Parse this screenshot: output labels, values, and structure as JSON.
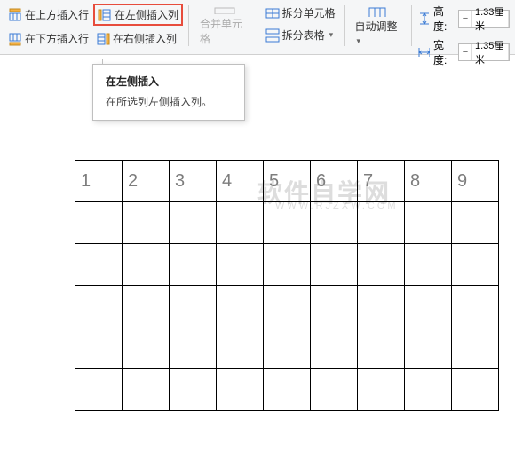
{
  "ribbon": {
    "insert": {
      "above": "在上方插入行",
      "below": "在下方插入行",
      "left": "在左侧插入列",
      "right": "在右侧插入列"
    },
    "merge": {
      "merge_cells": "合并单元格",
      "split_cells": "拆分单元格",
      "split_table": "拆分表格"
    },
    "autofit": "自动调整",
    "size": {
      "height_label": "高度:",
      "width_label": "宽度:",
      "height_value": "1.33厘米",
      "width_value": "1.35厘米"
    }
  },
  "tooltip": {
    "title": "在左侧插入",
    "body": "在所选列左侧插入列。"
  },
  "table": {
    "header": [
      "1",
      "2",
      "3",
      "4",
      "5",
      "6",
      "7",
      "8",
      "9"
    ],
    "rows": 6,
    "cols": 9,
    "cursor_cell": 2
  },
  "watermark": {
    "main": "软件自学网",
    "sub": "WWW.RJZXW.COM"
  }
}
